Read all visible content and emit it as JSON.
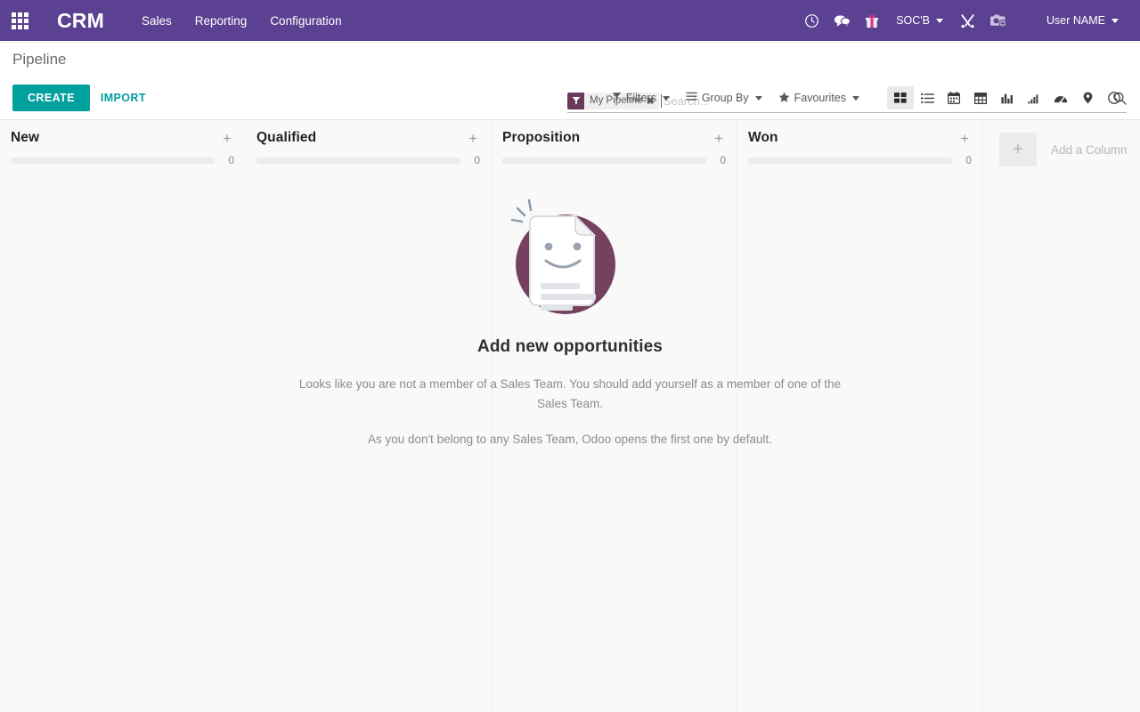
{
  "navbar": {
    "apps_icon": "apps-grid-icon",
    "brand": "CRM",
    "menus": [
      {
        "label": "Sales"
      },
      {
        "label": "Reporting"
      },
      {
        "label": "Configuration"
      }
    ],
    "icons": [
      {
        "name": "activity-clock-icon"
      },
      {
        "name": "messaging-chat-icon"
      },
      {
        "name": "gift-icon"
      }
    ],
    "company": {
      "label": "SOC'B"
    },
    "tools_icon": "tools-icon",
    "screenshot_icon": "camera-add-icon",
    "user": {
      "label": "User NAME"
    }
  },
  "control_panel": {
    "breadcrumb": "Pipeline",
    "create_label": "CREATE",
    "import_label": "IMPORT",
    "search": {
      "facet_icon": "filter-funnel-icon",
      "facet_label": "My Pipeline",
      "facet_remove": "✖",
      "placeholder": "Search...",
      "value": "",
      "search_icon": "magnifier-icon"
    },
    "dropdowns": [
      {
        "label": "Filters",
        "icon": "filter-funnel-icon"
      },
      {
        "label": "Group By",
        "icon": "hamburger-lines-icon"
      },
      {
        "label": "Favourites",
        "icon": "star-icon"
      }
    ],
    "views": [
      {
        "name": "kanban-view-icon",
        "active": true
      },
      {
        "name": "list-view-icon",
        "active": false
      },
      {
        "name": "calendar-view-icon",
        "active": false
      },
      {
        "name": "pivot-view-icon",
        "active": false
      },
      {
        "name": "graph-view-icon",
        "active": false
      },
      {
        "name": "cohort-view-icon",
        "active": false
      },
      {
        "name": "dashboard-view-icon",
        "active": false
      },
      {
        "name": "map-view-icon",
        "active": false
      },
      {
        "name": "activity-view-icon",
        "active": false
      }
    ]
  },
  "kanban": {
    "columns": [
      {
        "title": "New",
        "count": "0"
      },
      {
        "title": "Qualified",
        "count": "0"
      },
      {
        "title": "Proposition",
        "count": "0"
      },
      {
        "title": "Won",
        "count": "0"
      }
    ],
    "add_column": {
      "plus": "+",
      "label": "Add a Column"
    }
  },
  "empty_state": {
    "title": "Add new opportunities",
    "paragraph1": "Looks like you are not a member of a Sales Team. You should add yourself as a member of one of the Sales Team.",
    "paragraph2": "As you don't belong to any Sales Team, Odoo opens the first one by default."
  },
  "colors": {
    "navbar_purple": "#5c4192",
    "accent_teal": "#00a09d",
    "facet_plum": "#6b3a5b",
    "illustration_plum": "#76415f",
    "page_background": "#f9f9f9"
  }
}
